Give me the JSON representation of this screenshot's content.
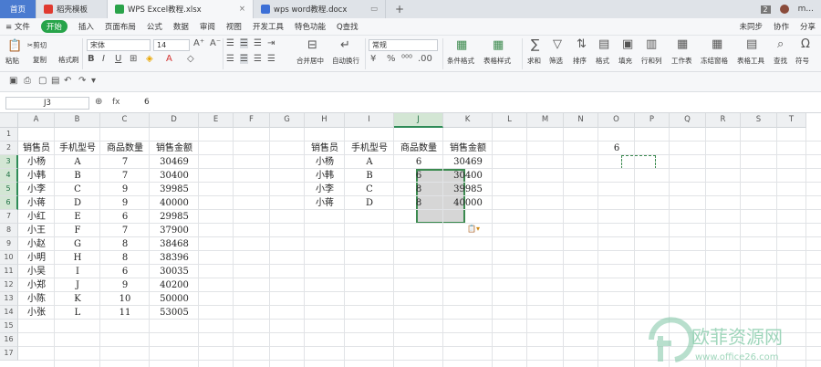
{
  "tabs": {
    "home": "首页",
    "t1": "稻壳模板",
    "t2": "WPS Excel教程.xlsx",
    "t3": "wps word教程.docx",
    "plus": "+",
    "badge": "2",
    "user": "m..."
  },
  "menu": {
    "file": "≡ 文件",
    "start": "开始",
    "items": [
      "插入",
      "页面布局",
      "公式",
      "数据",
      "审阅",
      "视图",
      "开发工具",
      "特色功能",
      "Q查找"
    ],
    "right": [
      "未同步",
      "协作",
      "分享"
    ]
  },
  "ribbon": {
    "paste": "粘贴",
    "cut": "✂剪切",
    "copy": "复制",
    "format_painter": "格式刷",
    "font": "宋体",
    "size": "14",
    "number_format": "常规",
    "merge": "合并居中",
    "wrap": "自动换行",
    "cond": "条件格式",
    "style": "表格样式",
    "sum": "求和",
    "filter": "筛选",
    "sort": "排序",
    "format": "格式",
    "fill": "填充",
    "rowcol": "行和列",
    "sheet": "工作表",
    "freeze": "冻结窗格",
    "tabletool": "表格工具",
    "find": "查找",
    "symbol": "符号"
  },
  "formula_bar": {
    "name_box": "J3",
    "fx": "fx",
    "value": "6"
  },
  "columns": [
    "A",
    "B",
    "C",
    "D",
    "E",
    "F",
    "G",
    "H",
    "I",
    "J",
    "K",
    "L",
    "M",
    "N",
    "O",
    "P",
    "Q",
    "R",
    "S",
    "T"
  ],
  "rows": [
    "1",
    "2",
    "3",
    "4",
    "5",
    "6",
    "7",
    "8",
    "9",
    "10",
    "11",
    "12",
    "13",
    "14",
    "15",
    "16",
    "17"
  ],
  "left_table": {
    "headers": [
      "销售员",
      "手机型号",
      "商品数量",
      "销售金额"
    ],
    "rows": [
      [
        "小杨",
        "A",
        "7",
        "30469"
      ],
      [
        "小韩",
        "B",
        "7",
        "30400"
      ],
      [
        "小李",
        "C",
        "9",
        "39985"
      ],
      [
        "小蒋",
        "D",
        "9",
        "40000"
      ],
      [
        "小红",
        "E",
        "6",
        "29985"
      ],
      [
        "小王",
        "F",
        "7",
        "37900"
      ],
      [
        "小赵",
        "G",
        "8",
        "38468"
      ],
      [
        "小明",
        "H",
        "8",
        "38396"
      ],
      [
        "小吴",
        "I",
        "6",
        "30035"
      ],
      [
        "小郑",
        "J",
        "9",
        "40200"
      ],
      [
        "小陈",
        "K",
        "10",
        "50000"
      ],
      [
        "小张",
        "L",
        "11",
        "53005"
      ]
    ]
  },
  "right_table": {
    "headers": [
      "销售员",
      "手机型号",
      "商品数量",
      "销售金额"
    ],
    "rows": [
      [
        "小杨",
        "A",
        "6",
        "30469"
      ],
      [
        "小韩",
        "B",
        "6",
        "30400"
      ],
      [
        "小李",
        "C",
        "8",
        "39985"
      ],
      [
        "小蒋",
        "D",
        "8",
        "40000"
      ]
    ]
  },
  "copied_cell": "6",
  "watermark": {
    "title": "欧菲资源网",
    "url": "www.office26.com"
  }
}
